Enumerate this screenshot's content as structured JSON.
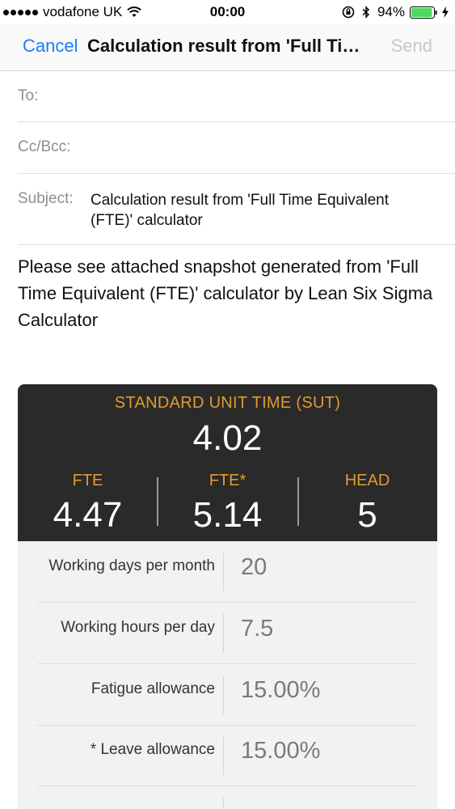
{
  "status_bar": {
    "carrier": "vodafone UK",
    "time": "00:00",
    "battery_percent": "94%",
    "battery_level": 0.94,
    "icons": [
      "signal-dots-icon",
      "wifi-icon",
      "rotation-lock-icon",
      "bluetooth-icon",
      "battery-icon",
      "charging-icon"
    ]
  },
  "nav": {
    "cancel_label": "Cancel",
    "title": "Calculation result from 'Full Time Equivalent (FTE)' calculator",
    "send_label": "Send"
  },
  "fields": {
    "to_label": "To:",
    "cc_label": "Cc/Bcc:",
    "subject_label": "Subject:",
    "subject_value": "Calculation result from 'Full Time Equivalent (FTE)' calculator"
  },
  "body": {
    "text": "Please see attached snapshot generated from 'Full Time Equivalent (FTE)' calculator by Lean Six Sigma Calculator"
  },
  "snapshot": {
    "sut_label": "STANDARD UNIT TIME (SUT)",
    "sut_value": "4.02",
    "metrics": [
      {
        "label": "FTE",
        "value": "4.47"
      },
      {
        "label": "FTE*",
        "value": "5.14"
      },
      {
        "label": "HEAD",
        "value": "5"
      }
    ],
    "params": [
      {
        "label": "Working days per month",
        "value": "20"
      },
      {
        "label": "Working hours per day",
        "value": "7.5"
      },
      {
        "label": "Fatigue allowance",
        "value": "15.00%"
      },
      {
        "label": "* Leave allowance",
        "value": "15.00%"
      },
      {
        "label": "",
        "value": ""
      }
    ]
  },
  "colors": {
    "accent_blue": "#1a7ff5",
    "accent_orange": "#e39a2e",
    "dark_panel": "#2a2a2a"
  }
}
